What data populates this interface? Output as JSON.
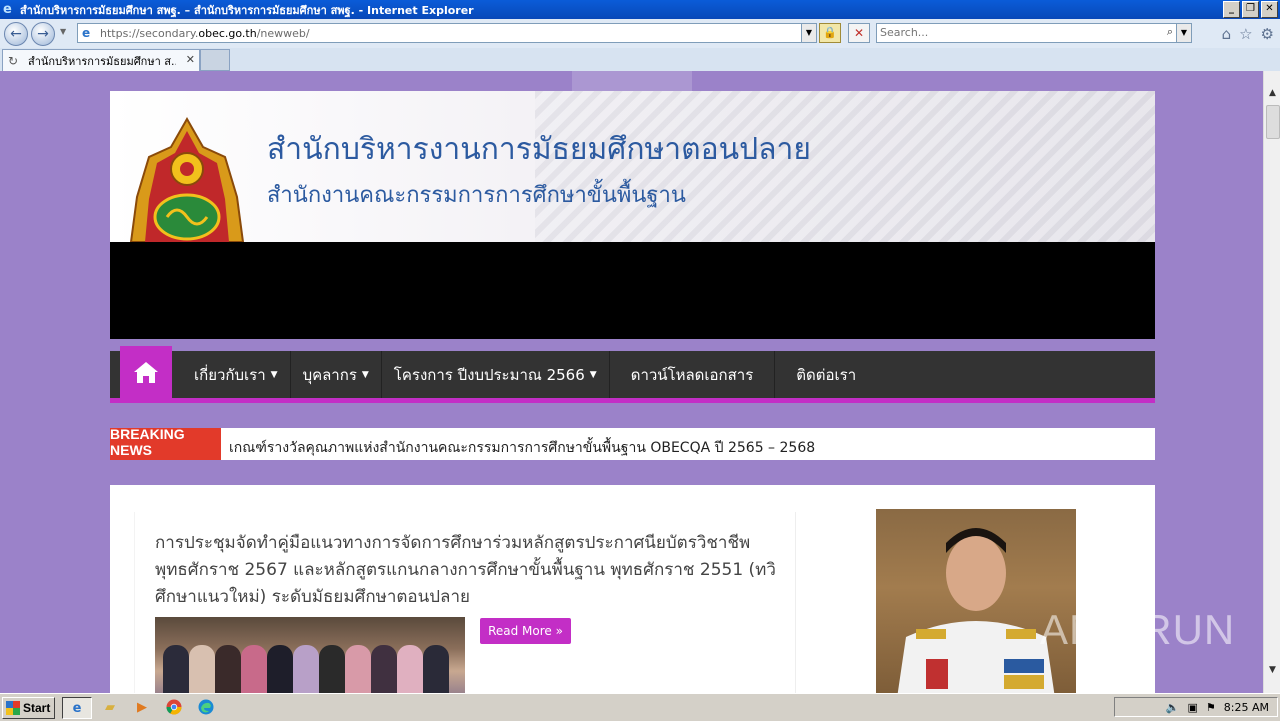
{
  "window": {
    "title": "สำนักบริหารการมัธยมศึกษา สพฐ. – สำนักบริหารการมัธยมศึกษา สพฐ. - Internet Explorer"
  },
  "address": {
    "url_prefix": "https://secondary.",
    "url_domain": "obec.go.th",
    "url_path": "/newweb/",
    "search_placeholder": "Search..."
  },
  "tab": {
    "title": "สำนักบริหารการมัธยมศึกษา ส..."
  },
  "site": {
    "title": "สำนักบริหารงานการมัธยมศึกษาตอนปลาย",
    "subtitle": "สำนักงานคณะกรรมการการศึกษาขั้นพื้นฐาน"
  },
  "menu": {
    "items": [
      {
        "label": "เกี่ยวกับเรา",
        "has_caret": true
      },
      {
        "label": "บุคลากร",
        "has_caret": true
      },
      {
        "label": "โครงการ ปีงบประมาณ 2566",
        "has_caret": true
      },
      {
        "label": "ดาวน์โหลดเอกสาร",
        "has_caret": false
      },
      {
        "label": "ติดต่อเรา",
        "has_caret": false
      }
    ]
  },
  "ticker": {
    "label": "BREAKING NEWS",
    "text": "เกณฑ์รางวัลคุณภาพแห่งสำนักงานคณะกรรมการการศึกษาขั้นพื้นฐาน OBECQA ปี 2565 – 2568"
  },
  "post": {
    "title": "การประชุมจัดทำคู่มือแนวทางการจัดการศึกษาร่วมหลักสูตรประกาศนียบัตรวิชาชีพ พุทธศักราช 2567 และหลักสูตรแกนกลางการศึกษาขั้นพื้นฐาน พุทธศักราช 2551 (ทวิศึกษาแนวใหม่) ระดับมัธยมศึกษาตอนปลาย",
    "read_more": "Read More »"
  },
  "watermark": "ANY RUN",
  "taskbar": {
    "start": "Start",
    "time": "8:25 AM"
  },
  "colors": {
    "accent": "#c32ec6",
    "menu_bg": "#333333",
    "page_bg": "#9b82c9",
    "breaking": "#e23a2a",
    "title_blue": "#2c5aa0"
  }
}
